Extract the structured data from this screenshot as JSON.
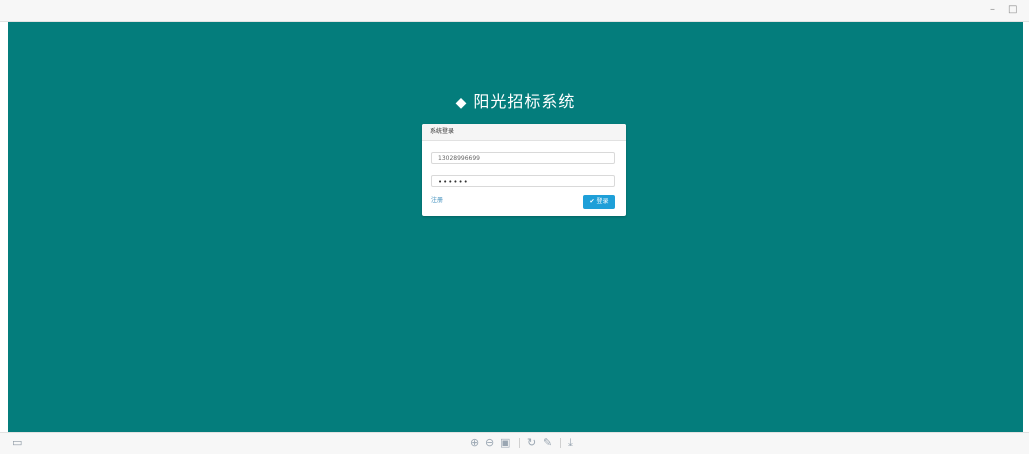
{
  "window": {
    "minimize": "–",
    "maximize": "□"
  },
  "app": {
    "logo_icon": "cube-icon",
    "title": "阳光招标系统"
  },
  "login_panel": {
    "header": "系统登录",
    "username_value": "13028996699",
    "password_value": "••••••",
    "register_link": "注册",
    "login_button": "登录"
  },
  "toolbar": {
    "icons": [
      "screen-icon",
      "zoom-in-icon",
      "zoom-out-icon",
      "fit-icon",
      "rotate-icon",
      "edit-icon",
      "download-icon"
    ]
  }
}
